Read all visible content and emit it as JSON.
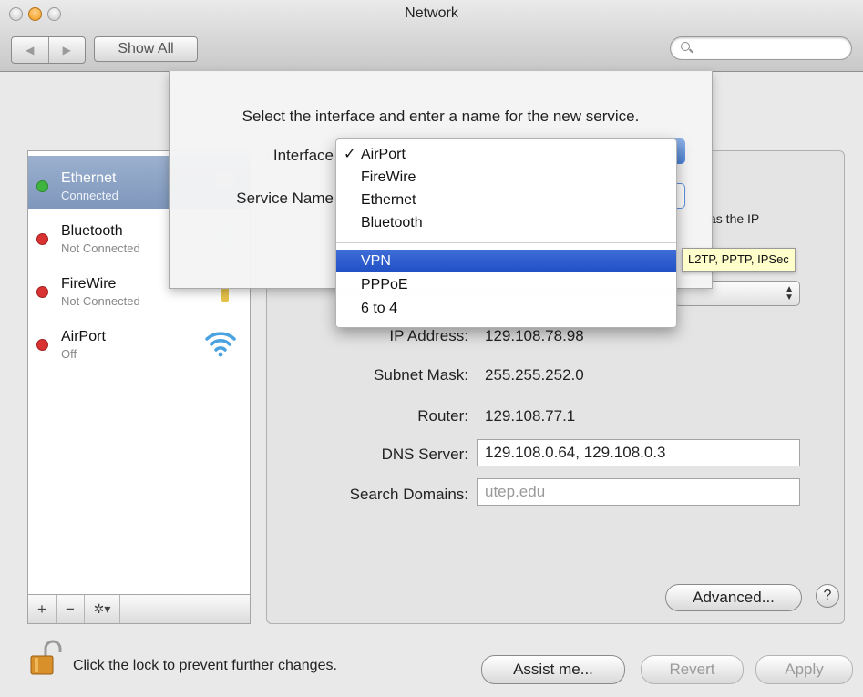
{
  "window": {
    "title": "Network"
  },
  "toolbar": {
    "show_all_label": "Show All",
    "back_glyph": "◀",
    "forward_glyph": "▶"
  },
  "sidebar": {
    "services": [
      {
        "name": "Ethernet",
        "status": "Connected",
        "status_color": "#3fb53f",
        "selected": true,
        "icon": "ethernet-icon"
      },
      {
        "name": "Bluetooth",
        "status": "Not Connected",
        "status_color": "#d93232",
        "selected": false,
        "icon": "bluetooth-icon"
      },
      {
        "name": "FireWire",
        "status": "Not Connected",
        "status_color": "#d93232",
        "selected": false,
        "icon": "firewire-icon"
      },
      {
        "name": "AirPort",
        "status": "Off",
        "status_color": "#d93232",
        "selected": false,
        "icon": "wifi-icon"
      }
    ],
    "tools": {
      "add": "+",
      "remove": "−",
      "gear": "✲▾"
    }
  },
  "details": {
    "partial_text": "as the IP",
    "ip_label": "IP Address:",
    "ip_value": "129.108.78.98",
    "subnet_label": "Subnet Mask:",
    "subnet_value": "255.255.252.0",
    "router_label": "Router:",
    "router_value": "129.108.77.1",
    "dns_label": "DNS Server:",
    "dns_value": "129.108.0.64, 129.108.0.3",
    "search_domains_label": "Search Domains:",
    "search_domains_value": "utep.edu",
    "advanced_label": "Advanced...",
    "help_label": "?"
  },
  "bottom": {
    "lock_text": "Click the lock to prevent further changes.",
    "assist_label": "Assist me...",
    "revert_label": "Revert",
    "apply_label": "Apply"
  },
  "sheet": {
    "title": "Select the interface and enter a name for the new service.",
    "interface_label": "Interface",
    "service_name_label": "Service Name"
  },
  "popup": {
    "check_glyph": "✓",
    "items": [
      "AirPort",
      "FireWire",
      "Ethernet",
      "Bluetooth",
      "VPN",
      "PPPoE",
      "6 to 4"
    ],
    "checked_index": 0,
    "highlighted_index": 4
  },
  "tooltip": {
    "text": "L2TP, PPTP, IPSec"
  },
  "colors": {
    "selection": "#2a59c8",
    "sidebar_selected": "#8ea4c6",
    "tooltip_bg": "#ffffcc"
  }
}
